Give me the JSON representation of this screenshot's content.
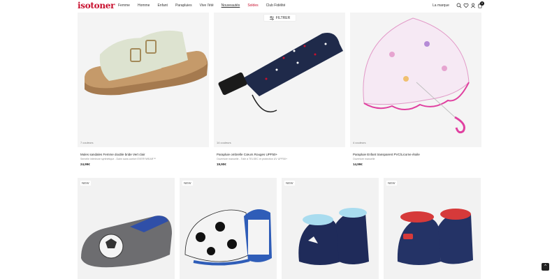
{
  "header": {
    "logo": "isotoner",
    "nav": [
      "Femme",
      "Homme",
      "Enfant",
      "Parapluies",
      "Vive l'été",
      "Nouveautés",
      "Soldes",
      "Club Fidélité"
    ],
    "brand_link": "La marque",
    "cart_count": "0"
  },
  "filter": {
    "label": "FILTRER"
  },
  "products_row1": [
    {
      "colors": "7 couleurs",
      "name": "Mules sandales Femme double bride Vert clair",
      "desc": "Semelle intérieure synthétique - Daim sans confort EVERYWEAR™",
      "price": "24,99€"
    },
    {
      "colors": "14 couleurs",
      "name": "Parapluie ombrelle Cœurs Rouges UPF50+",
      "desc": "Ouverture manuelle - Toile à TELSEC et protection UV UPF50+",
      "price": "19,90€"
    },
    {
      "colors": "4 couleurs",
      "name": "Parapluie Enfant transparent PVC/Licorne étoile",
      "desc": "Ouverture manuelle",
      "price": "14,99€"
    }
  ],
  "products_row2": [
    {
      "badge": "NEW"
    },
    {
      "badge": "NEW"
    },
    {
      "badge": "NEW"
    },
    {
      "badge": "NEW"
    }
  ],
  "back_to_top": "^"
}
